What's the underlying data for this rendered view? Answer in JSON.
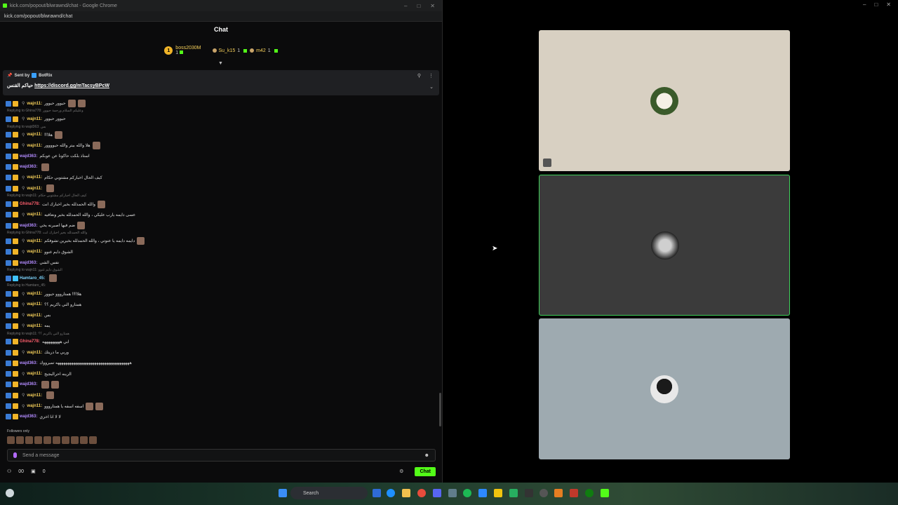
{
  "window": {
    "title": "kick.com/popout/blwrawnd/chat - Google Chrome",
    "url": "kick.com/popout/blwrawnd/chat"
  },
  "chat": {
    "header": "Chat",
    "leaderboard": [
      {
        "rank": "1",
        "name": "boss2030M",
        "count": "1"
      },
      {
        "name": "Su_k15",
        "count": "1"
      },
      {
        "name": "m42",
        "count": "1"
      }
    ],
    "pinned": {
      "sent_by": "Sent by",
      "bot": "BotRix",
      "text": "حياكم القنس",
      "link": "https://discord.gg/mTacsyBPcW"
    },
    "messages": [
      {
        "reply": "",
        "user": "wajn11:",
        "cls": "w",
        "text": "حيوور حيوور",
        "emo": 2
      },
      {
        "reply": "Replying to Ghina778: وعليكم السلام ورحمة حيوور",
        "user": "wajn11:",
        "cls": "w",
        "text": "حيوور حيوور",
        "emo": 0
      },
      {
        "reply": "Replying to wajd363: بس",
        "user": "wajn11:",
        "cls": "w",
        "text": "!!!هلا",
        "emo": 1
      },
      {
        "reply": "",
        "user": "wajn11:",
        "cls": "w",
        "text": "هلا والله بيتر والله حيوووور",
        "emo": 1
      },
      {
        "reply": "",
        "user": "wajd363:",
        "cls": "p",
        "text": "استاذ بلكت حاكونا عن عوبكم",
        "emo": 0
      },
      {
        "reply": "",
        "user": "wajd363:",
        "cls": "p",
        "text": "",
        "emo": 1
      },
      {
        "reply": "",
        "user": "wajn11:",
        "cls": "w",
        "text": "كيف الحال اخباركم مشتوبي حكام",
        "emo": 0
      },
      {
        "reply": "",
        "user": "wajn11:",
        "cls": "w",
        "text": "",
        "emo": 1
      },
      {
        "reply": "Replying to wajn11: كيف الحال اخباركم مشتوبي حكام",
        "user": "Ghina778:",
        "cls": "r",
        "text": "والله الحمدلله بخير اخبارك انت",
        "emo": 1
      },
      {
        "reply": "",
        "user": "wajn11:",
        "cls": "w",
        "text": "عسى دايمه يارب عليكي ، والله الحمدلله بخير ونعافيه",
        "emo": 0
      },
      {
        "reply": "",
        "user": "wajd363:",
        "cls": "p",
        "text": "ضم فيها اصبرنه يخي",
        "emo": 1
      },
      {
        "reply": "Replying to Ghina778: والله الحمدلله بخير اخبارك انت",
        "user": "wajn11:",
        "cls": "w",
        "text": "دايمه دايمه يا عنوتي ، والله الحمدلله بخيرين تشوفكم",
        "emo": 1
      },
      {
        "reply": "",
        "user": "wajn11:",
        "cls": "w",
        "text": "الشوق دايم غنوو",
        "emo": 0
      },
      {
        "reply": "",
        "user": "wajd363:",
        "cls": "p",
        "text": "نفس الشي",
        "emo": 0
      },
      {
        "reply": "Replying to wajn11: الشوق دايم غنوو",
        "user": "Hamtaro_45:",
        "cls": "c",
        "text": "",
        "emo": 1
      },
      {
        "reply": "Replying to Hamtaro_45:",
        "user": "wajn11:",
        "cls": "w",
        "text": "هلا!!!! همتارووو حيوور",
        "emo": 0
      },
      {
        "reply": "",
        "user": "wajn11:",
        "cls": "w",
        "text": "همتارو الني باكريم ؟؟",
        "emo": 0
      },
      {
        "reply": "",
        "user": "wajn11:",
        "cls": "w",
        "text": "بس",
        "emo": 0
      },
      {
        "reply": "",
        "user": "wajn11:",
        "cls": "w",
        "text": "يمه",
        "emo": 0
      },
      {
        "reply": "Replying to wajn11: همتارو الني باكريم ؟؟",
        "user": "Ghina778:",
        "cls": "r",
        "text": "ابي هههههههههه",
        "emo": 0
      },
      {
        "reply": "",
        "user": "wajn11:",
        "cls": "w",
        "text": "وربي ما دريتك",
        "emo": 0
      },
      {
        "reply": "",
        "user": "wajd363:",
        "cls": "p",
        "text": "ههههههههههههههههههههههههههههههههههههههه تميرووك",
        "emo": 0
      },
      {
        "reply": "",
        "user": "wajn11:",
        "cls": "w",
        "text": "الزينه احرالبجيج",
        "emo": 0
      },
      {
        "reply": "",
        "user": "wajd363:",
        "cls": "p",
        "text": "",
        "emo": 2
      },
      {
        "reply": "",
        "user": "wajn11:",
        "cls": "w",
        "text": "",
        "emo": 1
      },
      {
        "reply": "",
        "user": "wajn11:",
        "cls": "w",
        "text": "اسفه اسفه يا همتارووو",
        "emo": 2
      },
      {
        "reply": "",
        "user": "wajd363:",
        "cls": "p",
        "text": "لا لا انا اخزي",
        "emo": 0
      }
    ],
    "followers_only": "Followers only",
    "input_placeholder": "Send a message",
    "viewers": "00",
    "count2": "0",
    "send_label": "Chat"
  },
  "taskbar": {
    "search": "Search"
  }
}
